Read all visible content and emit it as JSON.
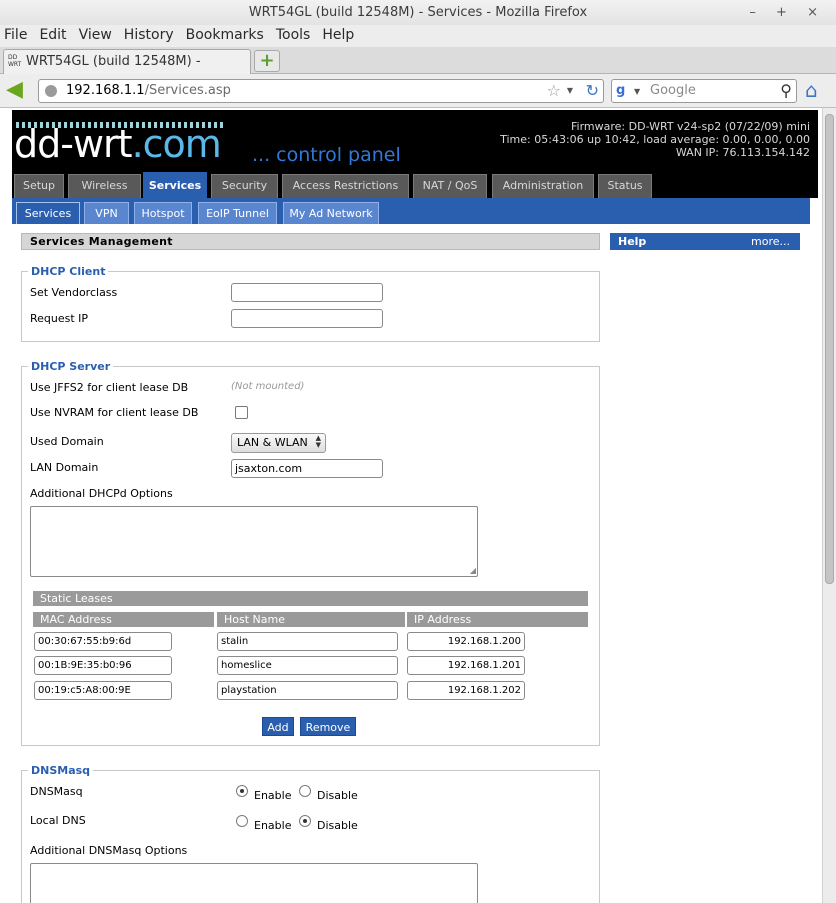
{
  "window": {
    "title": "WRT54GL (build 12548M) - Services - Mozilla Firefox",
    "controls": [
      "–",
      "+",
      "×"
    ]
  },
  "menu": [
    "File",
    "Edit",
    "View",
    "History",
    "Bookmarks",
    "Tools",
    "Help"
  ],
  "browser_tab": {
    "title": "WRT54GL (build 12548M) - Services",
    "favicon_text": "DD WRT"
  },
  "url": {
    "host": "192.168.1.1",
    "path": "/Services.asp"
  },
  "search": {
    "placeholder": "Google"
  },
  "header": {
    "logo_main": "dd-wrt",
    "logo_com": ".com",
    "tagline": "... control panel",
    "firmware": "Firmware: DD-WRT v24-sp2 (07/22/09) mini",
    "time": "Time: 05:43:06 up 10:42, load average: 0.00, 0.00, 0.00",
    "wan_ip": "WAN IP: 76.113.154.142"
  },
  "main_tabs": [
    "Setup",
    "Wireless",
    "Services",
    "Security",
    "Access Restrictions",
    "NAT / QoS",
    "Administration",
    "Status"
  ],
  "active_main_tab": "Services",
  "sub_tabs": [
    "Services",
    "VPN",
    "Hotspot",
    "EoIP Tunnel",
    "My Ad Network"
  ],
  "active_sub_tab": "Services",
  "section_title": "Services Management",
  "help": {
    "title": "Help",
    "more": "more..."
  },
  "dhcp_client": {
    "legend": "DHCP Client",
    "vendorclass_label": "Set Vendorclass",
    "vendorclass_value": "",
    "request_ip_label": "Request IP",
    "request_ip_value": ""
  },
  "dhcp_server": {
    "legend": "DHCP Server",
    "jffs2_label": "Use JFFS2 for client lease DB",
    "jffs2_note": "(Not mounted)",
    "nvram_label": "Use NVRAM for client lease DB",
    "nvram_checked": false,
    "used_domain_label": "Used Domain",
    "used_domain_value": "LAN & WLAN",
    "lan_domain_label": "LAN Domain",
    "lan_domain_value": "jsaxton.com",
    "additional_label": "Additional DHCPd Options",
    "static_leases_title": "Static Leases",
    "columns": [
      "MAC Address",
      "Host Name",
      "IP Address"
    ],
    "leases": [
      {
        "mac": "00:30:67:55:b9:6d",
        "host": "stalin",
        "ip": "192.168.1.200"
      },
      {
        "mac": "00:1B:9E:35:b0:96",
        "host": "homeslice",
        "ip": "192.168.1.201"
      },
      {
        "mac": "00:19:c5:A8:00:9E",
        "host": "playstation",
        "ip": "192.168.1.202"
      }
    ],
    "add_label": "Add",
    "remove_label": "Remove"
  },
  "dnsmasq": {
    "legend": "DNSMasq",
    "dnsmasq_label": "DNSMasq",
    "dnsmasq_value": "Enable",
    "local_dns_label": "Local DNS",
    "local_dns_value": "Disable",
    "enable_label": "Enable",
    "disable_label": "Disable",
    "additional_label": "Additional DNSMasq Options"
  }
}
